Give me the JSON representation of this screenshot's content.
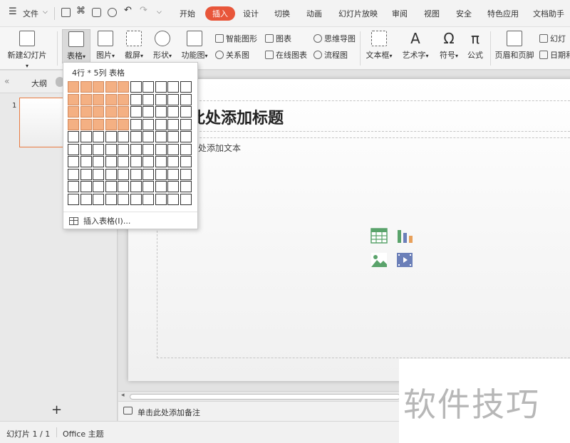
{
  "menu": {
    "file": "文件",
    "tabs": [
      "开始",
      "插入",
      "设计",
      "切换",
      "动画",
      "幻灯片放映",
      "审阅",
      "视图",
      "安全",
      "特色应用",
      "文档助手"
    ],
    "active_tab": "插入"
  },
  "ribbon": {
    "new_slide": "新建幻灯片",
    "table": "表格",
    "picture": "图片",
    "screenshot": "截屏",
    "shape": "形状",
    "function_chart": "功能图",
    "smart_graphic": "智能图形",
    "chart": "图表",
    "relation_chart": "关系图",
    "online_chart": "在线图表",
    "mind_map": "思维导图",
    "flowchart": "流程图",
    "textbox": "文本框",
    "wordart": "艺术字",
    "symbol": "符号",
    "formula": "公式",
    "header_footer": "页眉和页脚",
    "slide_number": "幻灯",
    "date_time": "日期和"
  },
  "left_pane": {
    "outline_tab": "大纲",
    "slide_number": "1",
    "add_symbol": "+"
  },
  "slide": {
    "title_placeholder": "此处添加标题",
    "body_placeholder": "此处添加文本"
  },
  "table_popup": {
    "header": "4行 * 5列 表格",
    "selected_rows": 4,
    "selected_cols": 5,
    "grid_rows": 10,
    "grid_cols": 10,
    "insert_table": "插入表格(I)..."
  },
  "notes": {
    "placeholder": "单击此处添加备注"
  },
  "status": {
    "slide_count": "幻灯片 1 / 1",
    "theme": "Office 主题"
  },
  "watermark": "软件技巧",
  "colors": {
    "accent": "#e8563a",
    "grid_selected": "#f4b083",
    "thumb_border": "#e8793f"
  }
}
